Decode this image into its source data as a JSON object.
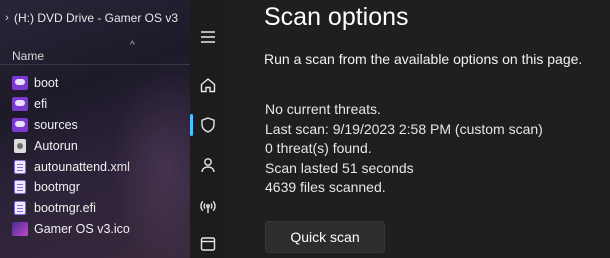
{
  "explorer": {
    "drive_title": "(H:) DVD Drive - Gamer OS v3",
    "column_header": "Name",
    "files": [
      {
        "name": "boot",
        "icon": "folder-icon",
        "kind": "folder"
      },
      {
        "name": "efi",
        "icon": "folder-icon",
        "kind": "folder"
      },
      {
        "name": "sources",
        "icon": "folder-icon",
        "kind": "folder"
      },
      {
        "name": "Autorun",
        "icon": "setup-icon",
        "kind": "setup"
      },
      {
        "name": "autounattend.xml",
        "icon": "document-icon",
        "kind": "doc"
      },
      {
        "name": "bootmgr",
        "icon": "document-icon",
        "kind": "doc"
      },
      {
        "name": "bootmgr.efi",
        "icon": "document-icon",
        "kind": "doc"
      },
      {
        "name": "Gamer OS v3.ico",
        "icon": "image-icon",
        "kind": "ico"
      }
    ]
  },
  "rail": {
    "items": [
      "menu-icon",
      "home-icon",
      "shield-icon",
      "person-icon",
      "wifi-icon",
      "app-browser-icon"
    ],
    "active": "shield-icon",
    "accent_color": "#4cc2ff"
  },
  "main": {
    "title": "Scan options",
    "subtitle": "Run a scan from the available options on this page.",
    "status_lines": [
      "No current threats.",
      "Last scan: 9/19/2023 2:58 PM (custom scan)",
      "0 threat(s) found.",
      "Scan lasted 51 seconds",
      "4639 files scanned."
    ],
    "quick_scan_label": "Quick scan"
  }
}
